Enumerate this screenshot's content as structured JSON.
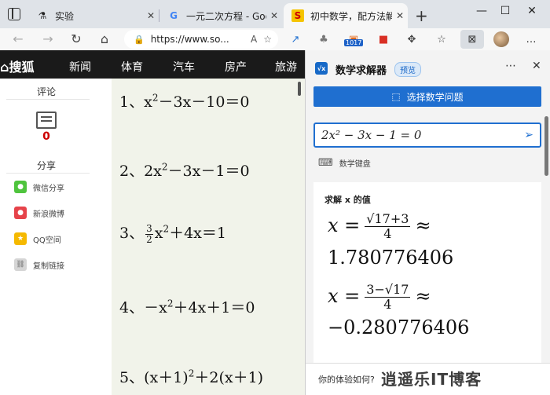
{
  "tabs": [
    {
      "title": "实验",
      "icon": "flask-icon"
    },
    {
      "title": "一元二次方程 - Google 搜",
      "icon": "google-icon"
    },
    {
      "title": "初中数学，配方法解一元",
      "icon": "sohu-icon",
      "active": true
    }
  ],
  "toolbar": {
    "url": "https://www.so..."
  },
  "extension_badge": "1017",
  "sohu": {
    "logo": "⌂搜狐",
    "nav": [
      "新闻",
      "体育",
      "汽车",
      "房产",
      "旅游"
    ],
    "comment_label": "评论",
    "comment_count": "0",
    "share_label": "分享",
    "share_items": [
      "微信分享",
      "新浪微博",
      "QQ空间",
      "复制链接"
    ]
  },
  "equations": [
    {
      "num": "1、",
      "parts": [
        "x",
        "2",
        "－3x－10＝0"
      ]
    },
    {
      "num": "2、",
      "parts": [
        "2x",
        "2",
        "－3x－1＝0"
      ]
    },
    {
      "num": "3、",
      "frac_n": "3",
      "frac_d": "2",
      "parts": [
        "x",
        "2",
        "＋4x＝1"
      ]
    },
    {
      "num": "4、",
      "parts": [
        "－x",
        "2",
        "＋4x＋1＝0"
      ]
    },
    {
      "num": "5、",
      "parts": [
        "(x＋1)",
        "2",
        "＋2(x＋1)"
      ]
    }
  ],
  "pane": {
    "title": "数学求解器",
    "badge": "预览",
    "select_button": "选择数学问题",
    "input_value": "2x² − 3x − 1 = 0",
    "keyboard_label": "数学键盘",
    "result_title": "求解 x 的值",
    "result1_num": "√17+3",
    "result1_den": "4",
    "result1_approx": "1.780776406",
    "result2_num": "3−√17",
    "result2_den": "4",
    "result2_approx": "−0.280776406",
    "feedback": "你的体验如何?",
    "watermark": "逍遥乐IT博客"
  }
}
